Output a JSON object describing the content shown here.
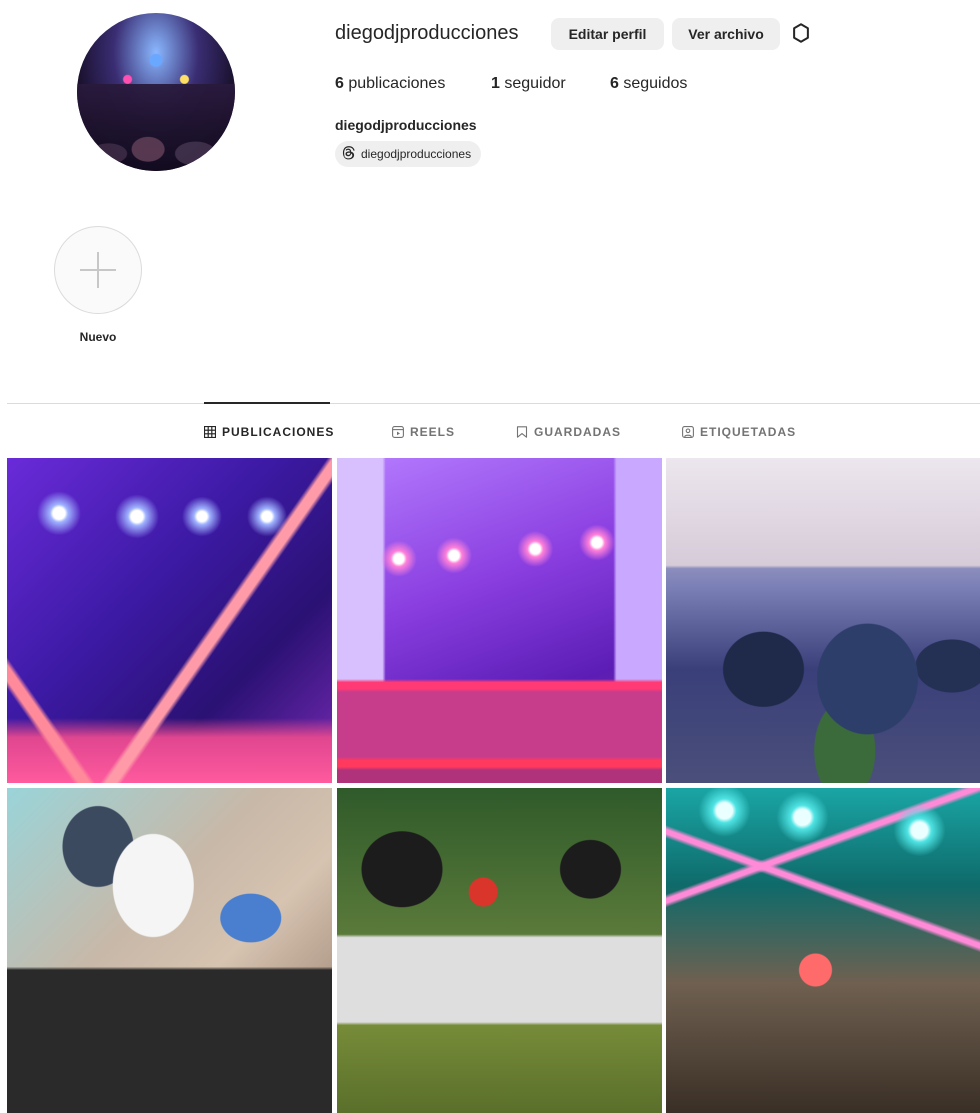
{
  "profile": {
    "username": "diegodjproducciones",
    "edit_profile_label": "Editar perfil",
    "archive_label": "Ver archivo",
    "stats": {
      "posts_count": "6",
      "posts_label": "publicaciones",
      "followers_count": "1",
      "followers_label": "seguidor",
      "following_count": "6",
      "following_label": "seguidos"
    },
    "full_name": "diegodjproducciones",
    "threads_handle": "diegodjproducciones"
  },
  "highlights": {
    "new_label": "Nuevo"
  },
  "tabs": [
    {
      "label": "PUBLICACIONES",
      "icon": "grid-icon",
      "active": true
    },
    {
      "label": "REELS",
      "icon": "reels-icon",
      "active": false
    },
    {
      "label": "GUARDADAS",
      "icon": "bookmark-icon",
      "active": false
    },
    {
      "label": "ETIQUETADAS",
      "icon": "tagged-icon",
      "active": false
    }
  ],
  "colors": {
    "button_bg": "#efefef",
    "text": "#262626",
    "muted": "#737373",
    "divider": "#dbdbdb"
  }
}
